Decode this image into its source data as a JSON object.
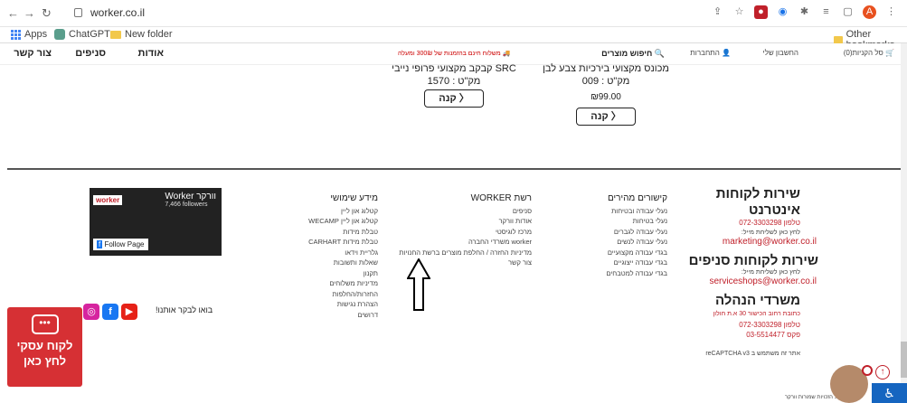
{
  "browser": {
    "url": "worker.co.il",
    "bookmarks": [
      "Apps",
      "ChatGPT",
      "New folder"
    ],
    "other_bookmarks": "Other bookmarks",
    "profile_letter": "A"
  },
  "nav": {
    "contact": "צור קשר",
    "branches": "סניפים",
    "about": "אודות",
    "shipping_msg": "משלוח חינם בהזמנות של 300₪ ומעלה",
    "search": "חיפוש מוצרים",
    "login": "התחברות",
    "account": "החשבון שלי",
    "cart": "סל הקניות(0)"
  },
  "products": [
    {
      "name": "מכונס מקצועי בירכיות צבע לבן",
      "sku": "מק\"ט : 009",
      "price": "₪99.00",
      "buy": "קנה"
    },
    {
      "name": "קבקב מקצועי פרופי נייבי SRC",
      "sku": "מק\"ט : 1570",
      "buy": "קנה"
    }
  ],
  "footer": {
    "svc_online_title": "שירות לקוחות אינטרנט",
    "svc_online_phone": "טלפון 072-3303298",
    "svc_online_note": "לחץ כאן לשליחת מייל:",
    "svc_online_email": "marketing@worker.co.il",
    "svc_branches_title": "שירות לקוחות סניפים",
    "svc_branches_note": "לחץ כאן לשליחת מייל:",
    "svc_branches_email": "serviceshops@worker.co.il",
    "office_title": "משרדי הנהלה",
    "office_address": "כתובת רחוב הכישור 30 א.ת חולון",
    "office_phone": "טלפון 072-3303298",
    "office_fax": "פקס 03-5514477",
    "recaptcha": "אתר זה משתמש ב reCAPTCHA v3",
    "copyright": "2023 © כל הזכויות שמורות וורקר",
    "quick_links_title": "קישורים מהירים",
    "quick_links": [
      "נעלי עבודה ובטיחות",
      "נעלי בטיחות",
      "נעלי עבודה לגברים",
      "נעלי עבודה לנשים",
      "בגדי עבודה מקצועיים",
      "בגדי עבודה ייצוגיים",
      "בגדי עבודה למטבחים"
    ],
    "network_title": "רשת WORKER",
    "network_links": [
      "סניפים",
      "אודות וורקר",
      "מרכז לוגיסטי",
      "worker משרדי החברה",
      "מדיניות החזרה / החלפת מוצרים ברשת החנויות",
      "צור קשר"
    ],
    "info_title": "מידע שימושי",
    "info_links": [
      "קטלוג און ליין",
      "קטלוג און ליין WECAMP",
      "טבלת מידות",
      "טבלת מידות CARHART",
      "גלריית וידאו",
      "שאלות ותשובות",
      "תקנון",
      "מדיניות משלוחים",
      "החזרות/החלפות",
      "הצהרת נגישות",
      "דרושים"
    ],
    "fb_name": "Worker וורקר",
    "fb_followers": "7,466 followers",
    "fb_follow": "Follow Page",
    "visit_us": "בואו לבקר אותנו!",
    "biz_button": "לקוח עסקי לחץ כאן"
  }
}
